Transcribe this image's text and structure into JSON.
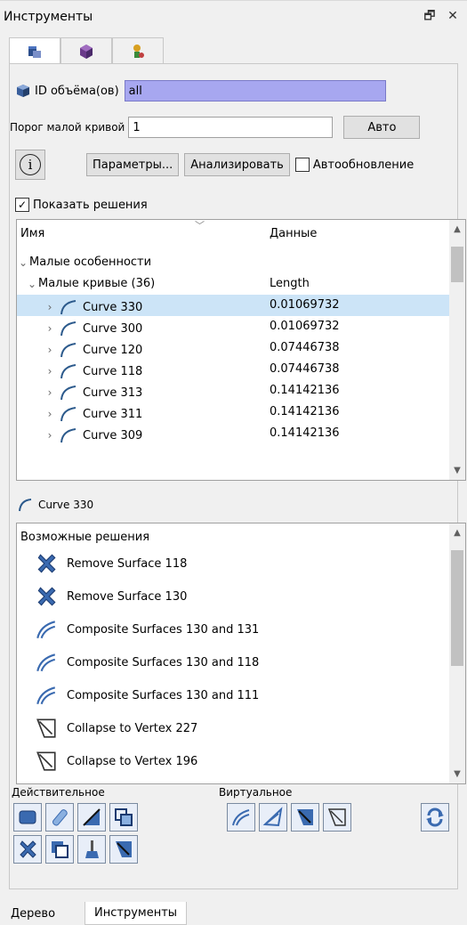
{
  "window": {
    "title": "Инструменты",
    "float_glyph": "🗗",
    "close_glyph": "✕"
  },
  "top_tabs": [
    {
      "icon": "volume-tool-icon",
      "active": true
    },
    {
      "icon": "geometry-cube-icon",
      "active": false
    },
    {
      "icon": "node-tool-icon",
      "active": false
    }
  ],
  "volume_ids": {
    "label": "ID объёма(ов)",
    "value": "all",
    "highlight": "#a7a7f0"
  },
  "small_curve": {
    "label": "Порог малой кривой",
    "value": "1",
    "auto_button": "Авто"
  },
  "actions": {
    "info_glyph": "i",
    "params_button": "Параметры...",
    "analyze_button": "Анализировать",
    "auto_update_label": "Автообновление",
    "auto_update_checked": false
  },
  "show_solutions": {
    "label": "Показать решения",
    "checked": true
  },
  "tree": {
    "header_name": "Имя",
    "header_data": "Данные",
    "group": "Малые особенности",
    "subgroup": "Малые кривые (36)",
    "subgroup_data": "Length",
    "rows": [
      {
        "name": "Curve 330",
        "value": "0.01069732",
        "selected": true
      },
      {
        "name": "Curve 300",
        "value": "0.01069732",
        "selected": false
      },
      {
        "name": "Curve 120",
        "value": "0.07446738",
        "selected": false
      },
      {
        "name": "Curve 118",
        "value": "0.07446738",
        "selected": false
      },
      {
        "name": "Curve 313",
        "value": "0.14142136",
        "selected": false
      },
      {
        "name": "Curve 311",
        "value": "0.14142136",
        "selected": false
      },
      {
        "name": "Curve 309",
        "value": "0.14142136",
        "selected": false
      }
    ]
  },
  "selected_label": "Curve 330",
  "solutions": {
    "header": "Возможные решения",
    "items": [
      {
        "label": "Remove Surface 118",
        "icon": "remove-surface-icon"
      },
      {
        "label": "Remove Surface 130",
        "icon": "remove-surface-icon"
      },
      {
        "label": "Composite Surfaces 130 and 131",
        "icon": "composite-surface-icon"
      },
      {
        "label": "Composite Surfaces 130 and 118",
        "icon": "composite-surface-icon"
      },
      {
        "label": "Composite Surfaces 130 and 111",
        "icon": "composite-surface-icon"
      },
      {
        "label": "Collapse to Vertex 227",
        "icon": "collapse-vertex-icon"
      },
      {
        "label": "Collapse to Vertex 196",
        "icon": "collapse-vertex-icon"
      }
    ]
  },
  "toolbar": {
    "real_label": "Действительное",
    "virtual_label": "Виртуальное"
  },
  "bottom_tabs": [
    {
      "label": "Дерево",
      "active": false
    },
    {
      "label": "Инструменты",
      "active": true
    }
  ],
  "colors": {
    "selection": "#cce4f7",
    "curve_icon": "#2c5a8c",
    "tool_fill": "#3a6ab0"
  }
}
